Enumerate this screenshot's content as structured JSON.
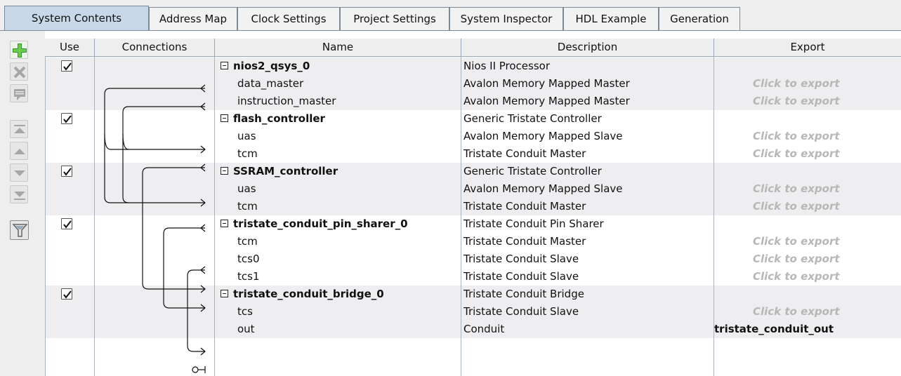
{
  "tabs": [
    {
      "label": "System Contents"
    },
    {
      "label": "Address Map"
    },
    {
      "label": "Clock Settings"
    },
    {
      "label": "Project Settings"
    },
    {
      "label": "System Inspector"
    },
    {
      "label": "HDL Example"
    },
    {
      "label": "Generation"
    }
  ],
  "toolbar": {
    "icons": [
      "add-icon",
      "remove-icon",
      "edit-icon",
      "move-top-icon",
      "move-up-icon",
      "move-down-icon",
      "move-bottom-icon",
      "filter-icon"
    ]
  },
  "table": {
    "headers": {
      "use": "Use",
      "connections": "Connections",
      "name": "Name",
      "description": "Description",
      "export": "Export"
    },
    "rows": [
      {
        "name": "nios2_qsys_0",
        "description": "Nios II Processor",
        "export": ""
      },
      {
        "name": "data_master",
        "description": "Avalon Memory Mapped Master",
        "export": "Click to export"
      },
      {
        "name": "instruction_master",
        "description": "Avalon Memory Mapped Master",
        "export": "Click to export"
      },
      {
        "name": "flash_controller",
        "description": "Generic Tristate Controller",
        "export": ""
      },
      {
        "name": "uas",
        "description": "Avalon Memory Mapped Slave",
        "export": "Click to export"
      },
      {
        "name": "tcm",
        "description": "Tristate Conduit Master",
        "export": "Click to export"
      },
      {
        "name": "SSRAM_controller",
        "description": "Generic Tristate Controller",
        "export": ""
      },
      {
        "name": "uas",
        "description": "Avalon Memory Mapped Slave",
        "export": "Click to export"
      },
      {
        "name": "tcm",
        "description": "Tristate Conduit Master",
        "export": "Click to export"
      },
      {
        "name": "tristate_conduit_pin_sharer_0",
        "description": "Tristate Conduit Pin Sharer",
        "export": ""
      },
      {
        "name": "tcm",
        "description": "Tristate Conduit Master",
        "export": "Click to export"
      },
      {
        "name": "tcs0",
        "description": "Tristate Conduit Slave",
        "export": "Click to export"
      },
      {
        "name": "tcs1",
        "description": "Tristate Conduit Slave",
        "export": "Click to export"
      },
      {
        "name": "tristate_conduit_bridge_0",
        "description": "Tristate Conduit Bridge",
        "export": ""
      },
      {
        "name": "tcs",
        "description": "Tristate Conduit Slave",
        "export": "Click to export"
      },
      {
        "name": "out",
        "description": "Conduit",
        "export": "tristate_conduit_out"
      }
    ]
  }
}
